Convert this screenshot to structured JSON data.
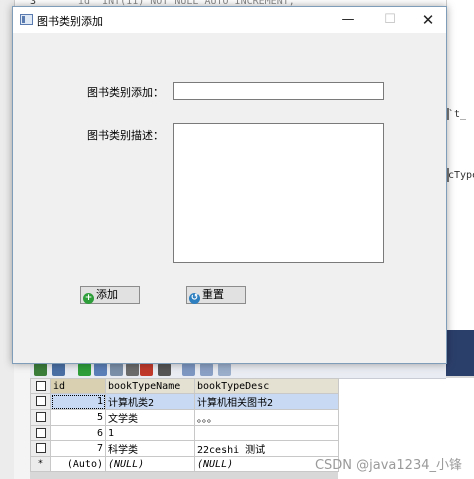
{
  "window": {
    "title": "图书类别添加",
    "minimize_glyph": "—",
    "maximize_glyph": "☐",
    "close_glyph": "✕"
  },
  "form": {
    "name_label": "图书类别添加：",
    "name_value": "",
    "desc_label": "图书类别描述：",
    "desc_value": "",
    "add_label": "添加",
    "reset_label": "重置",
    "add_icon": "add-icon",
    "reset_icon": "reset-icon"
  },
  "background": {
    "line_number": "3",
    "code_fragment": "`id` INT(11) NOT NULL AUTO_INCREMENT,",
    "side_fragment_1": "`t_",
    "side_fragment_2": "cType"
  },
  "result_grid": {
    "columns": [
      "id",
      "bookTypeName",
      "bookTypeDesc"
    ],
    "rows": [
      {
        "id": "1",
        "name": "计算机类2",
        "desc": "计算机相关图书2"
      },
      {
        "id": "5",
        "name": "文学类",
        "desc": "。。。"
      },
      {
        "id": "6",
        "name": "1",
        "desc": ""
      },
      {
        "id": "7",
        "name": "科学类",
        "desc": "22ceshi 测试"
      }
    ],
    "new_row": {
      "marker": "*",
      "id": "(Auto)",
      "name": "(NULL)",
      "desc": "(NULL)"
    }
  },
  "watermark": "CSDN @java1234_小锋",
  "colors": {
    "add_icon": "#2e9e3a",
    "reset_icon": "#2d7fc0",
    "selected_row": "#c7d9f3"
  }
}
